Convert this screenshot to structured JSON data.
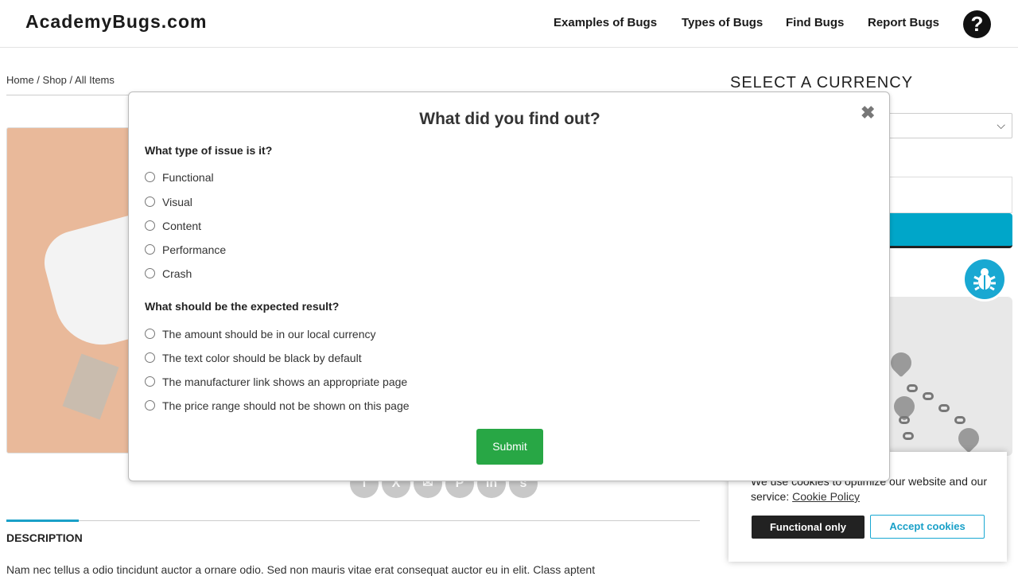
{
  "header": {
    "logo": "AcademyBugs.com",
    "nav": [
      "Examples of Bugs",
      "Types of Bugs",
      "Find Bugs",
      "Report Bugs"
    ],
    "help_glyph": "?"
  },
  "breadcrumb": {
    "home": "Home",
    "sep1": " / ",
    "shop": "Shop",
    "sep2": " / ",
    "current": "All Items"
  },
  "share_icons": [
    "facebook-icon",
    "x-icon",
    "email-icon",
    "pinterest-icon",
    "linkedin-icon",
    "stumbleupon-icon"
  ],
  "description": {
    "tab_title": "DESCRIPTION",
    "text": "Nam nec tellus a odio tincidunt auctor a ornare odio. Sed non mauris vitae erat consequat auctor eu in elit. Class aptent"
  },
  "sidebar": {
    "currency_title": "SELECT A CURRENCY"
  },
  "cookie_banner": {
    "text": "We use cookies to optimize our website and our service:",
    "link": "Cookie Policy",
    "functional_label": "Functional only",
    "accept_label": "Accept cookies"
  },
  "modal": {
    "title": "What did you find out?",
    "close_glyph": "✖",
    "question1": "What type of issue is it?",
    "issue_types": [
      "Functional",
      "Visual",
      "Content",
      "Performance",
      "Crash"
    ],
    "question2": "What should be the expected result?",
    "expected_results": [
      "The amount should be in our local currency",
      "The text color should be black by default",
      "The manufacturer link shows an appropriate page",
      "The price range should not be shown on this page"
    ],
    "submit_label": "Submit"
  },
  "colors": {
    "accent": "#19a0c8",
    "submit": "#28a745",
    "dark": "#222222"
  }
}
